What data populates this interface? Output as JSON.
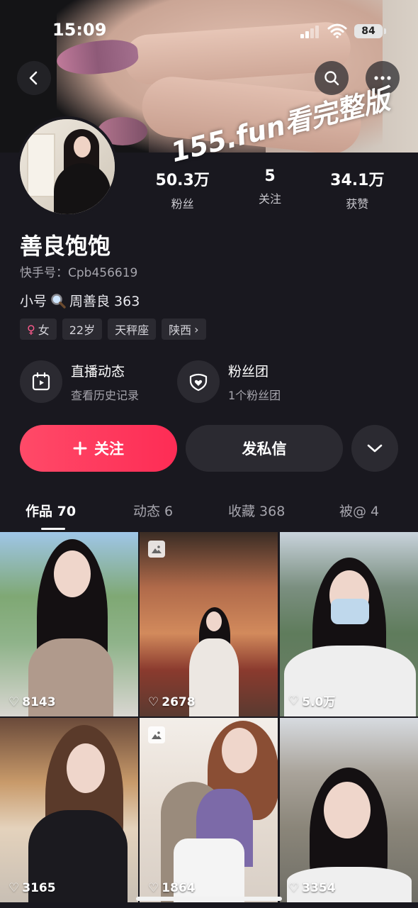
{
  "status_bar": {
    "time": "15:09",
    "battery": "84"
  },
  "watermark": "155.fun看完整版",
  "profile": {
    "name": "善良饱饱",
    "kuaishou_id": "快手号：Cpb456619",
    "bio_prefix": "小号",
    "bio_suffix": "周善良 363",
    "tags": {
      "gender": "女",
      "age": "22岁",
      "zodiac": "天秤座",
      "region": "陕西"
    }
  },
  "stats": [
    {
      "value": "50.3万",
      "label": "粉丝"
    },
    {
      "value": "5",
      "label": "关注"
    },
    {
      "value": "34.1万",
      "label": "获赞"
    }
  ],
  "entries": {
    "live": {
      "title": "直播动态",
      "subtitle": "查看历史记录"
    },
    "fans": {
      "title": "粉丝团",
      "subtitle": "1个粉丝团"
    }
  },
  "actions": {
    "follow": "关注",
    "message": "发私信"
  },
  "tabs": [
    {
      "label": "作品 70"
    },
    {
      "label": "动态 6"
    },
    {
      "label": "收藏 368"
    },
    {
      "label": "被@ 4"
    }
  ],
  "videos": [
    {
      "likes": "8143"
    },
    {
      "likes": "2678"
    },
    {
      "likes": "5.0万"
    },
    {
      "likes": "3165"
    },
    {
      "likes": "1864"
    },
    {
      "likes": "3354"
    }
  ],
  "colors": {
    "background": "#19181f",
    "follow_button": "#fe2c55",
    "chip": "#2b2a31"
  }
}
